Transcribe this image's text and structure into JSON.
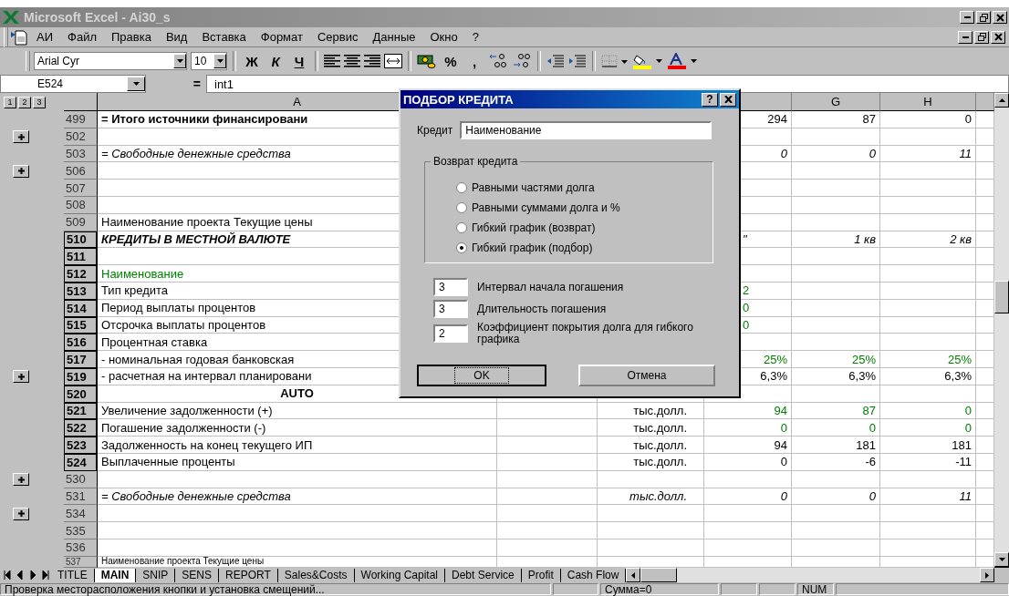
{
  "window": {
    "title": "Microsoft Excel - Ai30_s"
  },
  "menu": {
    "doc_label": "АИ",
    "items": [
      "Файл",
      "Правка",
      "Вид",
      "Вставка",
      "Формат",
      "Сервис",
      "Данные",
      "Окно",
      "?"
    ]
  },
  "toolbar": {
    "font": "Arial Cyr",
    "size": "10",
    "style_buttons": [
      "Ж",
      "К",
      "Ч"
    ],
    "number_buttons": [
      "%",
      ","
    ]
  },
  "formula_bar": {
    "cell": "E524",
    "equals": "=",
    "formula": "int1"
  },
  "outline_levels": [
    "1",
    "2",
    "3"
  ],
  "column_headers": {
    "a": "A",
    "g": "G",
    "h": "H"
  },
  "rows": [
    {
      "number": "499",
      "selected": false,
      "collapsed": false,
      "a": {
        "text": "= Итого источники финансировани",
        "kind": "bold"
      },
      "f": {
        "text": "294",
        "kind": "plain"
      },
      "g": {
        "text": "87",
        "kind": "plain"
      },
      "h": {
        "text": "0",
        "kind": "plain"
      }
    },
    {
      "number": "502",
      "selected": false,
      "collapsed": true
    },
    {
      "number": "503",
      "selected": false,
      "collapsed": false,
      "a": {
        "text": "= Свободные денежные средства",
        "kind": "italic"
      },
      "f": {
        "text": "0",
        "kind": "italic"
      },
      "g": {
        "text": "0",
        "kind": "italic"
      },
      "h": {
        "text": "11",
        "kind": "italic"
      }
    },
    {
      "number": "506",
      "selected": false,
      "collapsed": true
    },
    {
      "number": "507",
      "selected": false,
      "collapsed": false
    },
    {
      "number": "508",
      "selected": false,
      "collapsed": false
    },
    {
      "number": "509",
      "selected": false,
      "collapsed": false,
      "a": {
        "text": "Наименование проекта Текущие цены",
        "kind": "plain"
      }
    },
    {
      "number": "510",
      "selected": true,
      "collapsed": false,
      "a": {
        "text": "КРЕДИТЫ В МЕСТНОЙ ВАЛЮТЕ",
        "kind": "bolditalic"
      },
      "f": {
        "text": "\"",
        "kind": "italicleft"
      },
      "g": {
        "text": "1 кв",
        "kind": "italic"
      },
      "h": {
        "text": "2 кв",
        "kind": "italic"
      }
    },
    {
      "number": "511",
      "selected": true,
      "collapsed": false
    },
    {
      "number": "512",
      "selected": true,
      "collapsed": false,
      "a": {
        "text": "Наименование",
        "kind": "green"
      }
    },
    {
      "number": "513",
      "selected": true,
      "collapsed": false,
      "a": {
        "text": "Тип кредита",
        "kind": "plain"
      },
      "f": {
        "text": "2",
        "kind": "greenleft"
      }
    },
    {
      "number": "514",
      "selected": true,
      "collapsed": false,
      "a": {
        "text": "Период выплаты процентов",
        "kind": "plain"
      },
      "f": {
        "text": "0",
        "kind": "greenleft"
      }
    },
    {
      "number": "515",
      "selected": true,
      "collapsed": false,
      "a": {
        "text": "Отсрочка выплаты процентов",
        "kind": "plain"
      },
      "f": {
        "text": "0",
        "kind": "greenleft"
      }
    },
    {
      "number": "516",
      "selected": true,
      "collapsed": false,
      "a": {
        "text": "Процентная ставка",
        "kind": "plain"
      }
    },
    {
      "number": "517",
      "selected": true,
      "collapsed": false,
      "a": {
        "text": " - номинальная годовая банковская",
        "kind": "plain"
      },
      "f": {
        "text": "25%",
        "kind": "green"
      },
      "g": {
        "text": "25%",
        "kind": "green"
      },
      "h": {
        "text": "25%",
        "kind": "green"
      }
    },
    {
      "number": "519",
      "selected": true,
      "collapsed": true,
      "a": {
        "text": " - расчетная на интервал планировани",
        "kind": "plain"
      },
      "f": {
        "text": "6,3%",
        "kind": "plain"
      },
      "g": {
        "text": "6,3%",
        "kind": "plain"
      },
      "h": {
        "text": "6,3%",
        "kind": "plain"
      }
    },
    {
      "number": "520",
      "selected": true,
      "collapsed": false,
      "a": {
        "text": "AUTO",
        "kind": "heading"
      }
    },
    {
      "number": "521",
      "selected": true,
      "collapsed": false,
      "a": {
        "text": "Увеличение задолженности (+)",
        "kind": "plain"
      },
      "unit": {
        "text": "тыс.долл.",
        "kind": "plain"
      },
      "f": {
        "text": "94",
        "kind": "green"
      },
      "g": {
        "text": "87",
        "kind": "green"
      },
      "h": {
        "text": "0",
        "kind": "green"
      }
    },
    {
      "number": "522",
      "selected": true,
      "collapsed": false,
      "a": {
        "text": "Погашение задолженности (-)",
        "kind": "plain"
      },
      "unit": {
        "text": "тыс.долл.",
        "kind": "plain"
      },
      "f": {
        "text": "0",
        "kind": "green"
      },
      "g": {
        "text": "0",
        "kind": "green"
      },
      "h": {
        "text": "0",
        "kind": "green"
      }
    },
    {
      "number": "523",
      "selected": true,
      "collapsed": false,
      "a": {
        "text": "Задолженность на конец текущего ИП",
        "kind": "plain"
      },
      "unit": {
        "text": "тыс.долл.",
        "kind": "plain"
      },
      "f": {
        "text": "94",
        "kind": "plain"
      },
      "g": {
        "text": "181",
        "kind": "plain"
      },
      "h": {
        "text": "181",
        "kind": "plain"
      }
    },
    {
      "number": "524",
      "selected": true,
      "collapsed": false,
      "a": {
        "text": "Выплаченные проценты",
        "kind": "plain"
      },
      "unit": {
        "text": "тыс.долл.",
        "kind": "plain"
      },
      "f": {
        "text": "0",
        "kind": "plain"
      },
      "g": {
        "text": "-6",
        "kind": "plain"
      },
      "h": {
        "text": "-11",
        "kind": "plain"
      }
    },
    {
      "number": "530",
      "selected": false,
      "collapsed": true
    },
    {
      "number": "531",
      "selected": false,
      "collapsed": false,
      "a": {
        "text": " = Свободные денежные средства",
        "kind": "italic"
      },
      "unit": {
        "text": "тыс.долл.",
        "kind": "italic"
      },
      "f": {
        "text": "0",
        "kind": "italic"
      },
      "g": {
        "text": "0",
        "kind": "italic"
      },
      "h": {
        "text": "11",
        "kind": "italic"
      }
    },
    {
      "number": "534",
      "selected": false,
      "collapsed": true
    },
    {
      "number": "535",
      "selected": false,
      "collapsed": false
    },
    {
      "number": "536",
      "selected": false,
      "collapsed": false
    },
    {
      "number": "537",
      "selected": false,
      "collapsed": false,
      "a": {
        "text": "Наименование проекта Текущие цены",
        "kind": "small"
      }
    }
  ],
  "dialog": {
    "title": "ПОДБОР КРЕДИТА",
    "help": "?",
    "credit_label": "Кредит",
    "credit_value": "Наименование",
    "group_title": "Возврат кредита",
    "options": [
      {
        "label": "Равными частями долга",
        "selected": false
      },
      {
        "label": "Равными суммами долга и %",
        "selected": false
      },
      {
        "label": "Гибкий график (возврат)",
        "selected": false
      },
      {
        "label": "Гибкий график (подбор)",
        "selected": true
      }
    ],
    "params": [
      {
        "value": "3",
        "label": "Интервал начала погашения"
      },
      {
        "value": "3",
        "label": "Длительность погашения"
      },
      {
        "value": "2",
        "label": "Коэффициент  покрытия долга для гибкого графика"
      }
    ],
    "buttons": [
      {
        "label": "OK",
        "focused": true
      },
      {
        "label": "Отмена",
        "focused": false
      }
    ]
  },
  "sheet_tabs": [
    {
      "label": "TITLE",
      "selected": false
    },
    {
      "label": "MAIN",
      "selected": true
    },
    {
      "label": "SNIP",
      "selected": false
    },
    {
      "label": "SENS",
      "selected": false
    },
    {
      "label": "REPORT",
      "selected": false
    },
    {
      "label": "Sales&Costs",
      "selected": false
    },
    {
      "label": "Working Capital",
      "selected": false
    },
    {
      "label": "Debt Service",
      "selected": false
    },
    {
      "label": "Profit",
      "selected": false
    },
    {
      "label": "Cash Flow",
      "selected": false
    }
  ],
  "status_bar": {
    "message": "Проверка месторасположения кнопки и установка смещений...",
    "sum": "Сумма=0",
    "mode": "NUM"
  }
}
